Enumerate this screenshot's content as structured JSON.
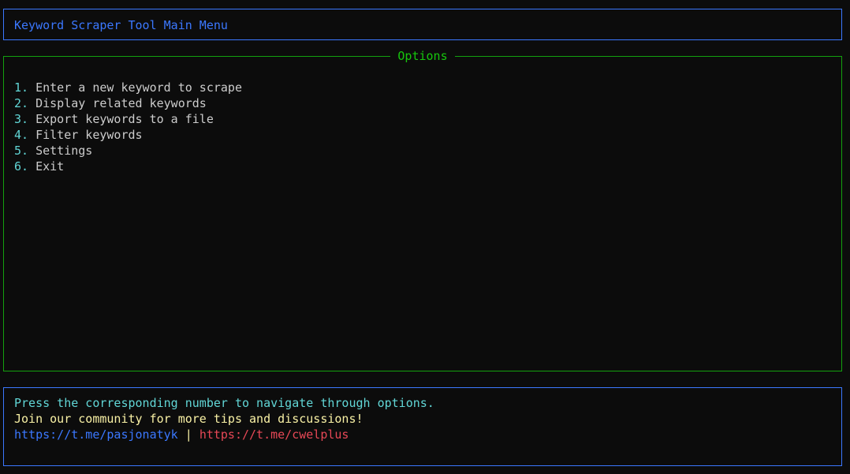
{
  "header": {
    "title": "Keyword Scraper Tool Main Menu"
  },
  "options": {
    "title": "Options",
    "items": [
      {
        "number": "1.",
        "label": "Enter a new keyword to scrape"
      },
      {
        "number": "2.",
        "label": "Display related keywords"
      },
      {
        "number": "3.",
        "label": "Export keywords to a file"
      },
      {
        "number": "4.",
        "label": "Filter keywords"
      },
      {
        "number": "5.",
        "label": "Settings"
      },
      {
        "number": "6.",
        "label": "Exit"
      }
    ]
  },
  "footer": {
    "instruction": "Press the corresponding number to navigate through options.",
    "community": "Join our community for more tips and discussions!",
    "link_1": "https://t.me/pasjonatyk",
    "separator": "|",
    "link_2": "https://t.me/cwelplus"
  },
  "colors": {
    "background": "#0c0c0c",
    "header_border": "#3b78ff",
    "options_border": "#13a10e",
    "options_title": "#16c60c",
    "number_color": "#61d6d6",
    "link_1_color": "#3b78ff",
    "link_2_color": "#e74856",
    "community_color": "#f9f1a5"
  }
}
